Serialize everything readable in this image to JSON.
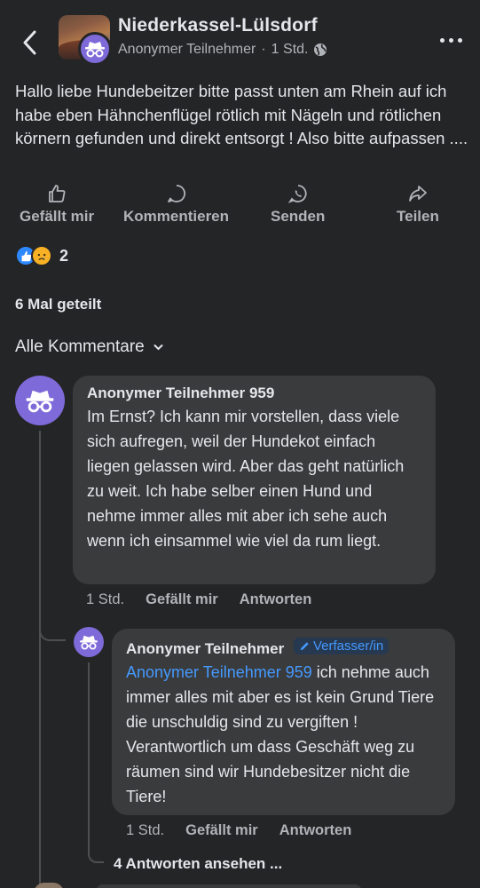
{
  "header": {
    "group_name": "Niederkassel-Lülsdorf",
    "author": "Anonymer Teilnehmer",
    "separator": "·",
    "time": "1 Std."
  },
  "post": {
    "text": "Hallo liebe Hundebeitzer bitte passt unten am Rhein auf ich habe eben Hähnchenflügel rötlich mit Nägeln und rötlichen körnern gefunden und direkt entsorgt ! Also bitte aufpassen ...."
  },
  "actions": {
    "like": "Gefällt mir",
    "comment": "Kommentieren",
    "send": "Senden",
    "share": "Teilen"
  },
  "reactions": {
    "count": "2"
  },
  "shares": "6 Mal geteilt",
  "comments_filter": "Alle Kommentare",
  "comments": [
    {
      "name": "Anonymer Teilnehmer 959",
      "text": "Im Ernst? Ich kann mir vorstellen, dass viele sich aufregen, weil der Hundekot einfach liegen gelassen wird. Aber das geht natürlich zu weit. Ich habe selber einen Hund und nehme immer alles mit aber ich sehe auch wenn ich einsammel wie viel da rum liegt.",
      "time": "1 Std.",
      "like": "Gefällt mir",
      "reply": "Antworten"
    }
  ],
  "reply": {
    "name": "Anonymer Teilnehmer",
    "badge": "Verfasser/in",
    "mention": "Anonymer Teilnehmer 959",
    "text": " ich nehme auch immer alles mit aber es ist kein Grund Tiere die unschuldig sind zu vergiften ! Verantwortlich um dass Geschäft weg zu räumen sind wir Hundebesitzer nicht die Tiere!",
    "time": "1 Std.",
    "like": "Gefällt mir",
    "reply_label": "Antworten"
  },
  "view_replies": "4 Antworten ansehen ...",
  "colors": {
    "background": "#242526",
    "bubble": "#3a3b3c",
    "avatar": "#7f6ad9",
    "accent": "#4599ff",
    "secondary_text": "#b0b3b8"
  }
}
